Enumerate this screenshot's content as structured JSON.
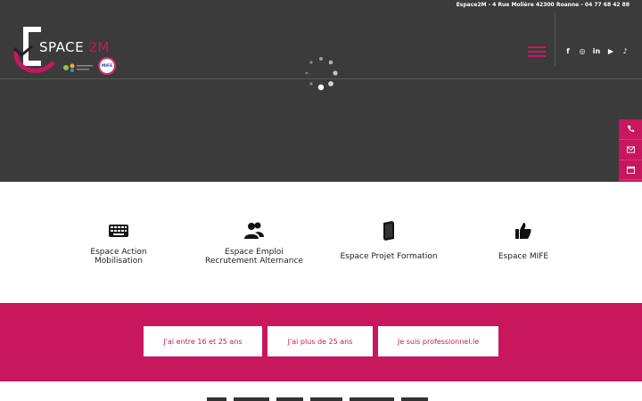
{
  "topbar": {
    "address": "Espace2M - 4 Rue Molière 42300 Roanne - 04 77 68 42 88"
  },
  "logo": {
    "space_text": "SPACE",
    "accent_text": " 2M",
    "badge_text": "MIFE"
  },
  "socials": [
    {
      "icon": "facebook-icon",
      "glyph": "f"
    },
    {
      "icon": "instagram-icon",
      "glyph": "◎"
    },
    {
      "icon": "linkedin-icon",
      "glyph": "in"
    },
    {
      "icon": "youtube-icon",
      "glyph": "▶"
    },
    {
      "icon": "tiktok-icon",
      "glyph": "♪"
    }
  ],
  "side_dock": [
    {
      "icon": "phone-icon"
    },
    {
      "icon": "mail-icon"
    },
    {
      "icon": "calendar-icon"
    },
    {
      "icon": "handshake-icon"
    },
    {
      "icon": "edit-icon"
    }
  ],
  "services": [
    {
      "icon": "keyboard-icon",
      "label_line1": "Espace Action",
      "label_line2": "Mobilisation"
    },
    {
      "icon": "users-icon",
      "label_line1": "Espace Emploi",
      "label_line2": "Recrutement Alternance"
    },
    {
      "icon": "book-icon",
      "label_line1": "Espace Projet Formation",
      "label_line2": ""
    },
    {
      "icon": "thumbs-up-icon",
      "label_line1": "Espace MIFE",
      "label_line2": ""
    }
  ],
  "cta_buttons": [
    {
      "label": "J'ai entre 16 et 25 ans"
    },
    {
      "label": "J'ai plus de 25 ans"
    },
    {
      "label": "Je suis professionnel.le"
    }
  ],
  "colors": {
    "accent": "#c8175d",
    "header_bg": "#3b3b3b",
    "white": "#ffffff"
  }
}
